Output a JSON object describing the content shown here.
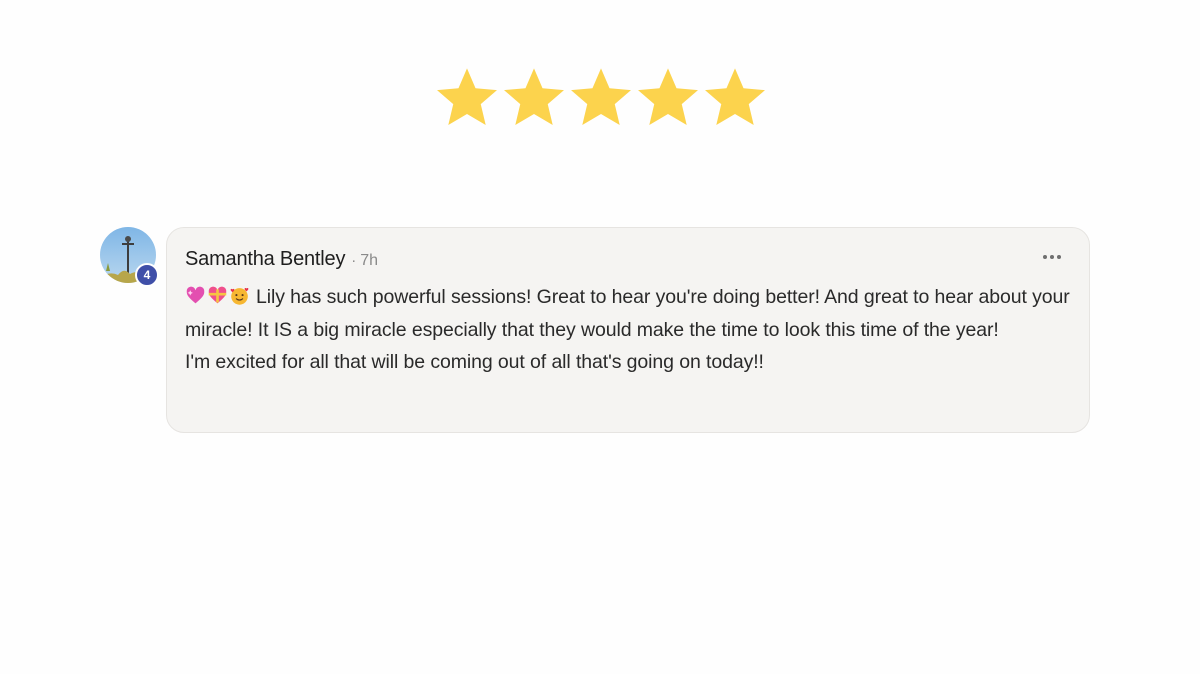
{
  "rating": {
    "value": 5,
    "max": 5,
    "color": "#fcd34d"
  },
  "comment": {
    "author": "Samantha Bentley",
    "separator": "·",
    "time": "7h",
    "avatar_badge": "4",
    "emojis": [
      "sparkling-heart-icon",
      "heart-with-ribbon-icon",
      "smiling-face-with-hearts-icon"
    ],
    "paragraphs": [
      "Lily has such powerful sessions! Great to hear you're doing better! And great to hear about your miracle! It IS a big miracle especially that they would make the time to look this time of the year!",
      "I'm excited for all that will be coming out of all that's going on today!!"
    ]
  },
  "colors": {
    "bubble_bg": "#f5f4f2",
    "badge_bg": "#3f4fa8",
    "star": "#fcd34d"
  }
}
